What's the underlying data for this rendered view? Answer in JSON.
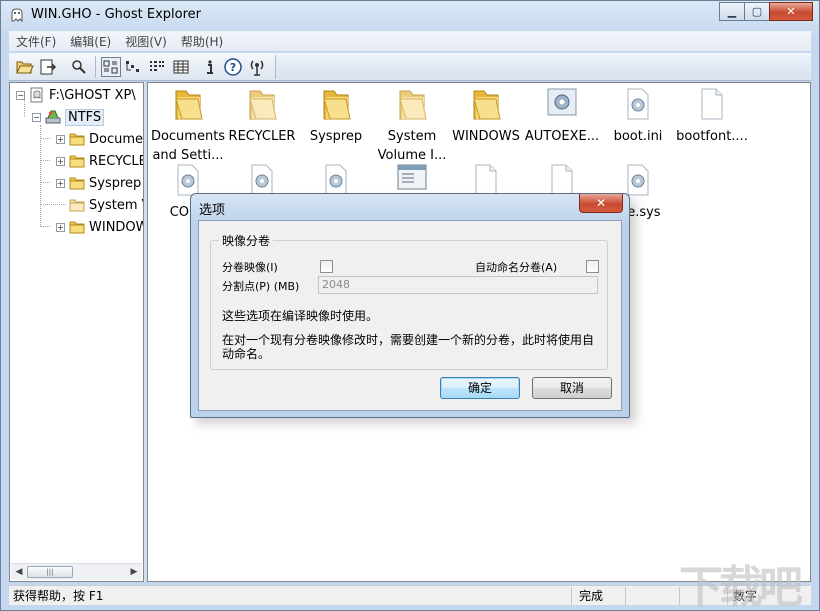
{
  "window": {
    "title": "WIN.GHO - Ghost Explorer"
  },
  "caption": {
    "minimize": "▁",
    "maximize": "▢",
    "close": "✕"
  },
  "menu": [
    "文件(F)",
    "编辑(E)",
    "视图(V)",
    "帮助(H)"
  ],
  "toolbar": [
    "open-icon",
    "extract-icon",
    "find-icon",
    "large-icons-view-icon",
    "small-icons-view-icon",
    "list-view-icon",
    "details-view-icon",
    "info-icon",
    "help-icon",
    "antenna-icon"
  ],
  "tree": {
    "root": "F:\\GHOST XP\\",
    "partition": "NTFS",
    "items": [
      "Documents and Settings",
      "RECYCLER",
      "Sysprep",
      "System Volume Information",
      "WINDOWS"
    ]
  },
  "files": {
    "row1": [
      {
        "name": "Documents\nand Setti...",
        "icon": "folder-icon"
      },
      {
        "name": "RECYCLER",
        "icon": "folder-icon"
      },
      {
        "name": "Sysprep",
        "icon": "folder-icon"
      },
      {
        "name": "System\nVolume I...",
        "icon": "folder-icon"
      },
      {
        "name": "WINDOWS",
        "icon": "folder-icon"
      },
      {
        "name": "AUTOEXE...",
        "icon": "settings-file-icon"
      },
      {
        "name": "boot.ini",
        "icon": "settings-file-icon"
      },
      {
        "name": "bootfont....",
        "icon": "file-icon"
      }
    ],
    "row2": [
      {
        "name": "CONF",
        "icon": "settings-file-icon"
      },
      {
        "name": "",
        "icon": "settings-file-icon"
      },
      {
        "name": "",
        "icon": "settings-file-icon"
      },
      {
        "name": "",
        "icon": "application-icon"
      },
      {
        "name": "",
        "icon": "file-icon"
      },
      {
        "name": "",
        "icon": "file-icon"
      },
      {
        "name": "file.sys",
        "icon": "settings-file-icon"
      }
    ]
  },
  "status": {
    "help": "获得帮助，按 F1",
    "state": "完成",
    "mode": "数字"
  },
  "dialog": {
    "title": "选项",
    "close": "✕",
    "group_title": "映像分卷",
    "span_label": "分卷映像(I)",
    "autoname_label": "自动命名分卷(A)",
    "split_label": "分割点(P) (MB)",
    "split_value": "2048",
    "note1": "这些选项在编译映像时使用。",
    "note2": "在对一个现有分卷映像修改时，需要创建一个新的分卷，此时将使用自动命名。",
    "ok": "确定",
    "cancel": "取消"
  },
  "watermark": "下载吧"
}
